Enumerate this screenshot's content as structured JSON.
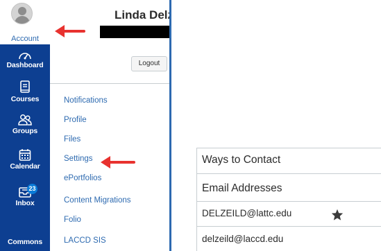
{
  "account_menu": {
    "user_name": "Linda Delz",
    "logout_label": "Logout",
    "links": [
      {
        "label": "Notifications"
      },
      {
        "label": "Profile"
      },
      {
        "label": "Files"
      },
      {
        "label": "Settings"
      },
      {
        "label": "ePortfolios"
      },
      {
        "label": "Content Migrations"
      },
      {
        "label": "Folio"
      },
      {
        "label": "LACCD SIS"
      }
    ]
  },
  "global_nav": {
    "account_label": "Account",
    "items": [
      {
        "label": "Dashboard",
        "icon": "dashboard-icon"
      },
      {
        "label": "Courses",
        "icon": "courses-icon"
      },
      {
        "label": "Groups",
        "icon": "groups-icon"
      },
      {
        "label": "Calendar",
        "icon": "calendar-icon"
      },
      {
        "label": "Inbox",
        "icon": "inbox-icon",
        "badge": "23"
      },
      {
        "label": "Commons",
        "icon": ""
      }
    ]
  },
  "ways_to_contact": {
    "title": "Ways to Contact",
    "section_label": "Email Addresses",
    "emails": [
      {
        "address": "DELZEILD@lattc.edu",
        "default": true
      },
      {
        "address": "delzeild@laccd.edu",
        "default": false
      }
    ]
  },
  "colors": {
    "nav_background": "#0d3f91",
    "link": "#2d6ab0",
    "arrow": "#e8322f"
  }
}
